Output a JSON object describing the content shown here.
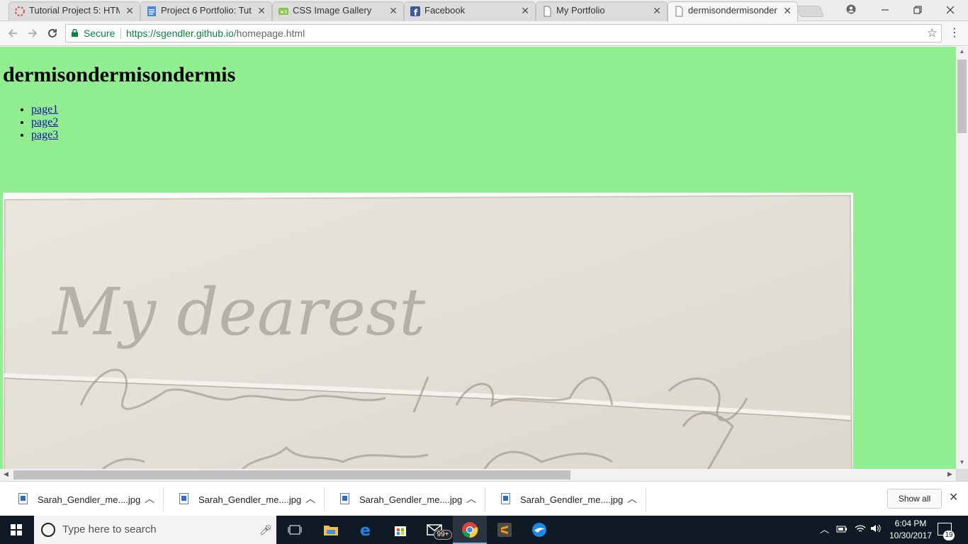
{
  "browser": {
    "tabs": [
      {
        "title": "Tutorial Project 5: HTML",
        "icon": "tutorial-favicon",
        "active": false
      },
      {
        "title": "Project 6 Portfolio: Tuto",
        "icon": "google-docs-favicon",
        "active": false
      },
      {
        "title": "CSS Image Gallery",
        "icon": "w3schools-favicon",
        "active": false
      },
      {
        "title": "Facebook",
        "icon": "facebook-favicon",
        "active": false
      },
      {
        "title": "My Portfolio",
        "icon": "page-favicon",
        "active": false
      },
      {
        "title": "dermisondermisonderm",
        "icon": "page-favicon",
        "active": true
      }
    ],
    "close_glyph": "✕",
    "security_label": "Secure",
    "url_host": "https://sgendler.github.io",
    "url_path": "/homepage.html"
  },
  "page": {
    "title": "dermisondermisondermis",
    "nav": [
      "page1",
      "page2",
      "page3"
    ],
    "image_alt": "handwritten letter scan",
    "handwriting": "My dearest"
  },
  "downloads": {
    "items": [
      {
        "name": "Sarah_Gendler_me....jpg"
      },
      {
        "name": "Sarah_Gendler_me....jpg"
      },
      {
        "name": "Sarah_Gendler_me....jpg"
      },
      {
        "name": "Sarah_Gendler_me....jpg"
      }
    ],
    "show_all": "Show all"
  },
  "taskbar": {
    "search_placeholder": "Type here to search",
    "mail_badge": "99+",
    "time": "6:04 PM",
    "date": "10/30/2017",
    "notifications": "19"
  },
  "colors": {
    "page_background": "#90ee90",
    "secure_green": "#0b8043",
    "taskbar": "#101a24"
  }
}
